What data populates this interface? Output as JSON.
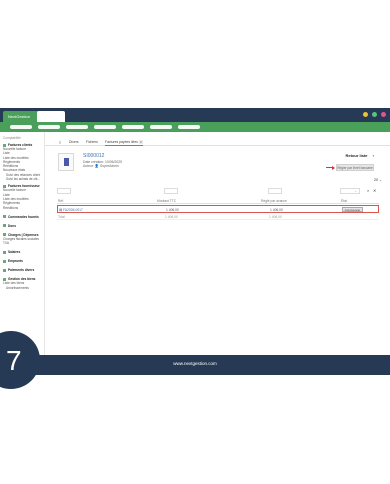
{
  "app": {
    "brand": "NextGestion"
  },
  "sidebar": {
    "header": "Comptabilité",
    "sections": [
      {
        "title": "Factures clients",
        "items": [
          "Nouvelle facture",
          "Liste",
          "Liste des modèles",
          "Règlements",
          "Rééditions",
          "Nouveaux états"
        ],
        "subitems": [
          "Suivi des relances client",
          "Suivi les achats de clé..."
        ]
      },
      {
        "title": "Factures fournisseur",
        "items": [
          "Nouvelle facture",
          "Liste",
          "Liste des modèles",
          "Règlements",
          "Rééditions"
        ]
      },
      {
        "title": "Commandes fournis",
        "items": []
      },
      {
        "title": "Dons",
        "items": []
      },
      {
        "title": "Charges | Dépenses",
        "items": [
          "Charges fiscales sociales",
          "TVA"
        ]
      },
      {
        "title": "Salaires",
        "items": []
      },
      {
        "title": "Emprunts",
        "items": []
      },
      {
        "title": "Paiements divers",
        "items": []
      },
      {
        "title": "Gestion des biens",
        "items": [
          "Liste des biens",
          "Amortissements"
        ]
      }
    ]
  },
  "tabs": [
    {
      "label": "Divers"
    },
    {
      "label": "Fichiers"
    },
    {
      "label": "Factures payées liées",
      "count": "0"
    }
  ],
  "card": {
    "ref": "SI000012",
    "date_created": "Date création: 10/06/2025",
    "author": "Auteur: 👤 SuperAdmin",
    "back_link": "Retour liste",
    "pay_button": "Régler par livret bancaire"
  },
  "pagesize": "20",
  "table": {
    "headers": [
      "Réf.",
      "Montant TTC",
      "Réglé par avance",
      "État"
    ],
    "row": {
      "ref": "FA2306-0017",
      "amount": "1 406,00",
      "paid": "1 406,00",
      "action": "Commencer"
    },
    "total": {
      "label": "Total",
      "amount": "1 406,00",
      "paid": "1 406,00"
    }
  },
  "footer": {
    "url": "www.nextgestion.com"
  },
  "step": {
    "number": "7"
  },
  "colors": {
    "navy": "#263a55",
    "green": "#4aa05a",
    "highlight": "#d9534f",
    "link": "#3f72a7"
  }
}
